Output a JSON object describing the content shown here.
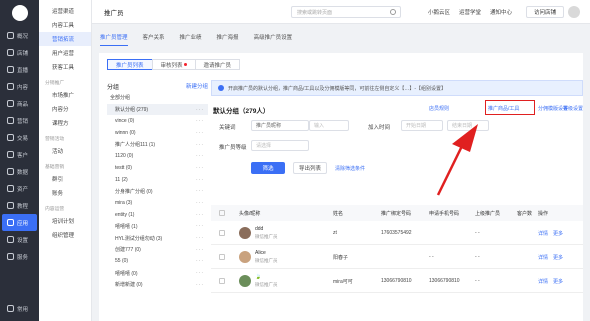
{
  "sidebar": {
    "items": [
      {
        "label": "概况"
      },
      {
        "label": "店铺"
      },
      {
        "label": "直播"
      },
      {
        "label": "内容"
      },
      {
        "label": "商品"
      },
      {
        "label": "营销"
      },
      {
        "label": "交易"
      },
      {
        "label": "客户"
      },
      {
        "label": "数据"
      },
      {
        "label": "资产"
      },
      {
        "label": "教程"
      },
      {
        "label": "应用"
      },
      {
        "label": "设置"
      },
      {
        "label": "服务"
      }
    ],
    "bottom": "常用"
  },
  "subnav": {
    "items_top": [
      "运营渠道",
      "内容工具",
      "营销拓流",
      "用户运营",
      "获客工具"
    ],
    "group1": "分销推广",
    "items_g1": [
      "市场推广",
      "内容分",
      "课程方"
    ],
    "group2": "营销活动",
    "items_g2": [
      "活动"
    ],
    "group3": "基础营销",
    "items_g3": [
      "群引",
      "账务"
    ],
    "group4": "内容运营",
    "items_g4": [
      "培训计划",
      "组织管理"
    ]
  },
  "topbar": {
    "title": "推广员",
    "search_placeholder": "搜索或跳转页面",
    "links": [
      "小鹅云区",
      "运营学堂",
      "通知中心"
    ],
    "visit": "访问店铺"
  },
  "tabs1": [
    "推广员管理",
    "客户关系",
    "推广业绩",
    "推广海报",
    "高级推广员设置"
  ],
  "tabs2": [
    "推广员列表",
    "审核列表",
    "邀请推广员"
  ],
  "groups": {
    "title": "分组",
    "add": "新建分组",
    "items": [
      {
        "label": "全部分组",
        "root": true
      },
      {
        "label": "默认分组 (279)",
        "sel": true
      },
      {
        "label": "vince (0)"
      },
      {
        "label": "winnn (0)"
      },
      {
        "label": "推广人分组111 (1)"
      },
      {
        "label": "1120 (0)"
      },
      {
        "label": "testt (0)"
      },
      {
        "label": "11 (2)"
      },
      {
        "label": "分身推广分组 (0)"
      },
      {
        "label": "mira (3)"
      },
      {
        "label": "entity (1)"
      },
      {
        "label": "嘻嘻嘻 (1)"
      },
      {
        "label": "HYL测试分组勿动 (3)"
      },
      {
        "label": "创建777 (0)"
      },
      {
        "label": "55 (0)"
      },
      {
        "label": "嘻嘻嘻 (0)"
      },
      {
        "label": "新增新建 (0)"
      }
    ]
  },
  "notice": "开启推广员的默认分组，推广商品/工具以及分佣模版等同，可前往左侧自定义【…】-【组别设置】",
  "group_title": "默认分组（279人）",
  "actions": [
    "店员规则",
    "推广商品/工具",
    "分佣模版设置",
    "等级设置"
  ],
  "form": {
    "keyword_label": "关键词",
    "keyword_select": "推广员昵称",
    "keyword_placeholder": "输入",
    "join_label": "加入时间",
    "date_start": "开始日期",
    "date_end": "结束日期",
    "channel_label": "推广员等级",
    "channel_select": "请选择"
  },
  "buttons": {
    "filter": "筛选",
    "export": "导出列表",
    "reset": "清除筛选条件"
  },
  "table": {
    "headers": [
      "头像/昵称",
      "姓名",
      "推广绑定号码",
      "申请手机号码",
      "上级推广员",
      "客户数",
      "操作"
    ],
    "rows": [
      {
        "name": "ddd",
        "sub": "微信推广员",
        "realname": "zt",
        "bind": "17603575492",
        "phone": "",
        "parent": "- -",
        "ops": [
          "详情",
          "更多"
        ]
      },
      {
        "name": "Alice",
        "sub": "微信推广员",
        "realname": "阳春子",
        "bind": "",
        "phone": "- -",
        "parent": "- -",
        "ops": [
          "详情",
          "更多"
        ]
      },
      {
        "name": "🍃",
        "sub": "微信推广员",
        "realname": "mira可可",
        "bind": "13066790810",
        "phone": "13066790810",
        "parent": "- -",
        "ops": [
          "详情",
          "更多"
        ]
      }
    ]
  }
}
